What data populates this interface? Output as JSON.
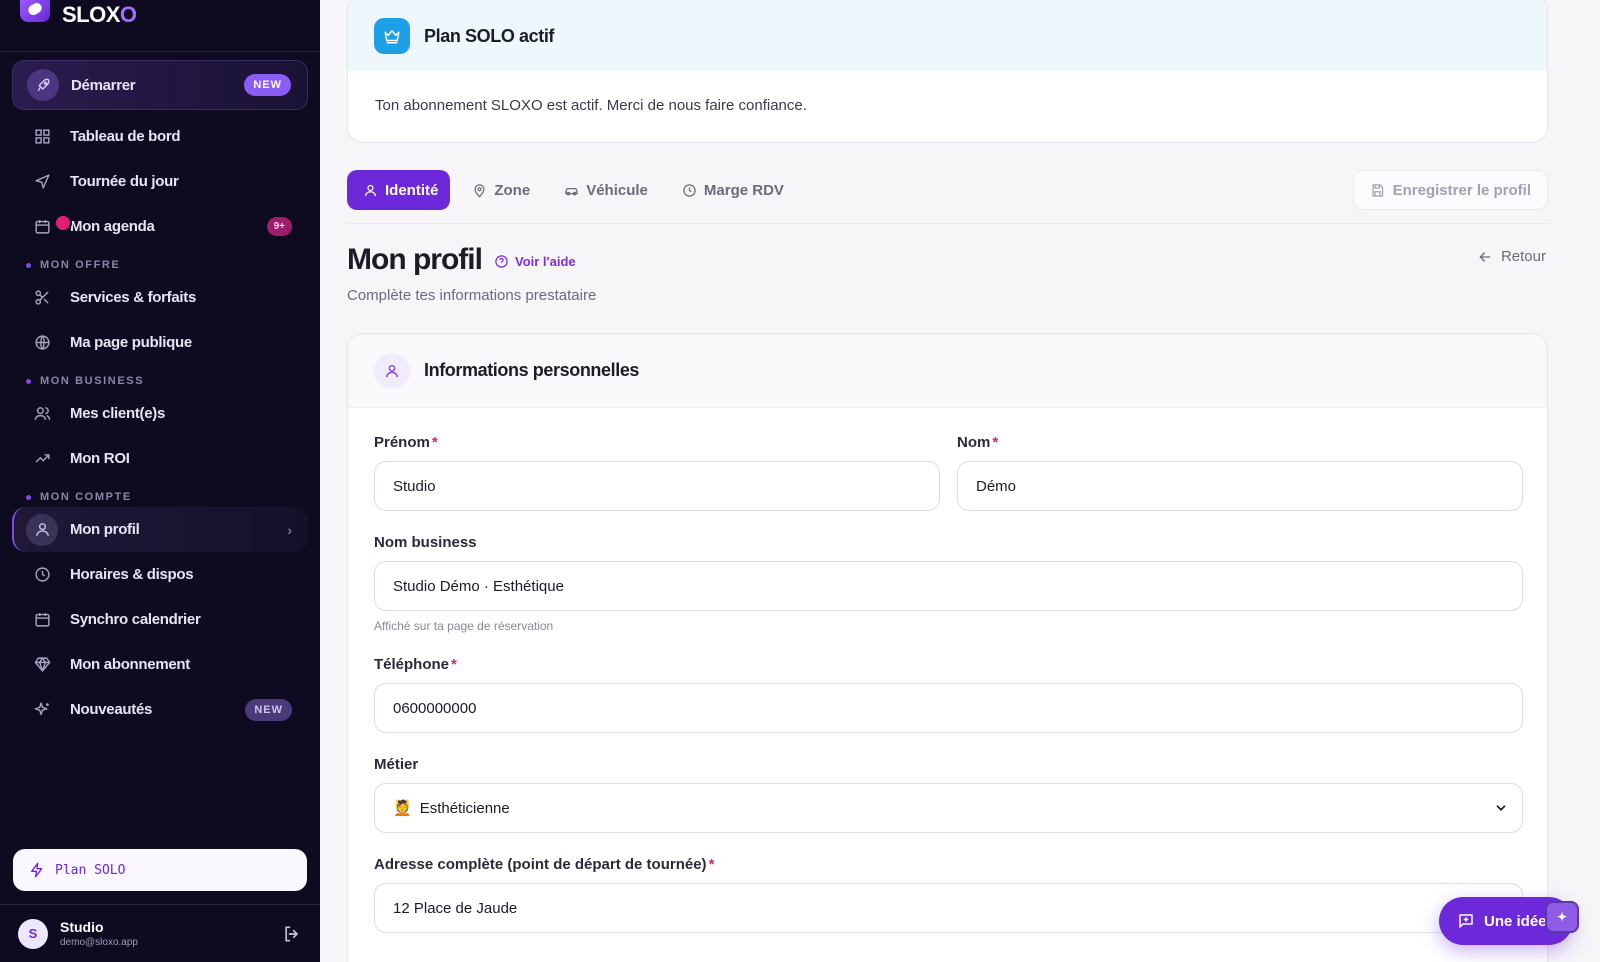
{
  "brand": {
    "name_main": "SLOX",
    "name_accent": "O"
  },
  "sidebar": {
    "start": {
      "label": "Démarrer",
      "badge": "NEW"
    },
    "items_top": [
      {
        "label": "Tableau de bord",
        "icon": "dashboard-icon"
      },
      {
        "label": "Tournée du jour",
        "icon": "navigation-icon"
      },
      {
        "label": "Mon agenda",
        "icon": "calendar-icon",
        "badge": "9+"
      }
    ],
    "section_offre": "MON OFFRE",
    "items_offre": [
      {
        "label": "Services & forfaits",
        "icon": "scissors-icon"
      },
      {
        "label": "Ma page publique",
        "icon": "globe-icon"
      }
    ],
    "section_business": "MON BUSINESS",
    "items_business": [
      {
        "label": "Mes client(e)s",
        "icon": "users-icon"
      },
      {
        "label": "Mon ROI",
        "icon": "trending-up-icon"
      }
    ],
    "section_compte": "MON COMPTE",
    "items_compte": [
      {
        "label": "Mon profil",
        "icon": "user-icon"
      },
      {
        "label": "Horaires & dispos",
        "icon": "clock-icon"
      },
      {
        "label": "Synchro calendrier",
        "icon": "calendar-sync-icon"
      },
      {
        "label": "Mon abonnement",
        "icon": "diamond-icon"
      },
      {
        "label": "Nouveautés",
        "icon": "sparkles-icon",
        "badge": "NEW"
      }
    ],
    "plan_label": "Plan SOLO",
    "user": {
      "initial": "S",
      "name": "Studio",
      "email": "demo@sloxo.app"
    }
  },
  "plan_card": {
    "title": "Plan SOLO actif",
    "text": "Ton abonnement SLOXO est actif. Merci de nous faire confiance."
  },
  "tabs": [
    {
      "label": "Identité",
      "icon": "user-icon",
      "active": true
    },
    {
      "label": "Zone",
      "icon": "map-pin-icon"
    },
    {
      "label": "Véhicule",
      "icon": "car-icon"
    },
    {
      "label": "Marge RDV",
      "icon": "clock-icon"
    }
  ],
  "save_button": "Enregistrer le profil",
  "page": {
    "title": "Mon profil",
    "help": "Voir l'aide",
    "back": "Retour",
    "subtitle": "Complète tes informations prestataire"
  },
  "form": {
    "title": "Informations personnelles",
    "prenom": {
      "label": "Prénom",
      "value": "Studio"
    },
    "nom": {
      "label": "Nom",
      "value": "Démo"
    },
    "business": {
      "label": "Nom business",
      "value": "Studio Démo · Esthétique",
      "hint": "Affiché sur ta page de réservation"
    },
    "telephone": {
      "label": "Téléphone",
      "value": "0600000000"
    },
    "metier": {
      "label": "Métier",
      "emoji": "💆",
      "value": "Esthéticienne"
    },
    "adresse": {
      "label": "Adresse complète (point de départ de tournée)",
      "value": "12 Place de Jaude"
    }
  },
  "idea_button": "Une idée ?",
  "colors": {
    "accent": "#6d28d9",
    "sidebar_bg": "#0e0a1f",
    "required": "#e11d74",
    "plan_icon": "#1ea0e6"
  }
}
